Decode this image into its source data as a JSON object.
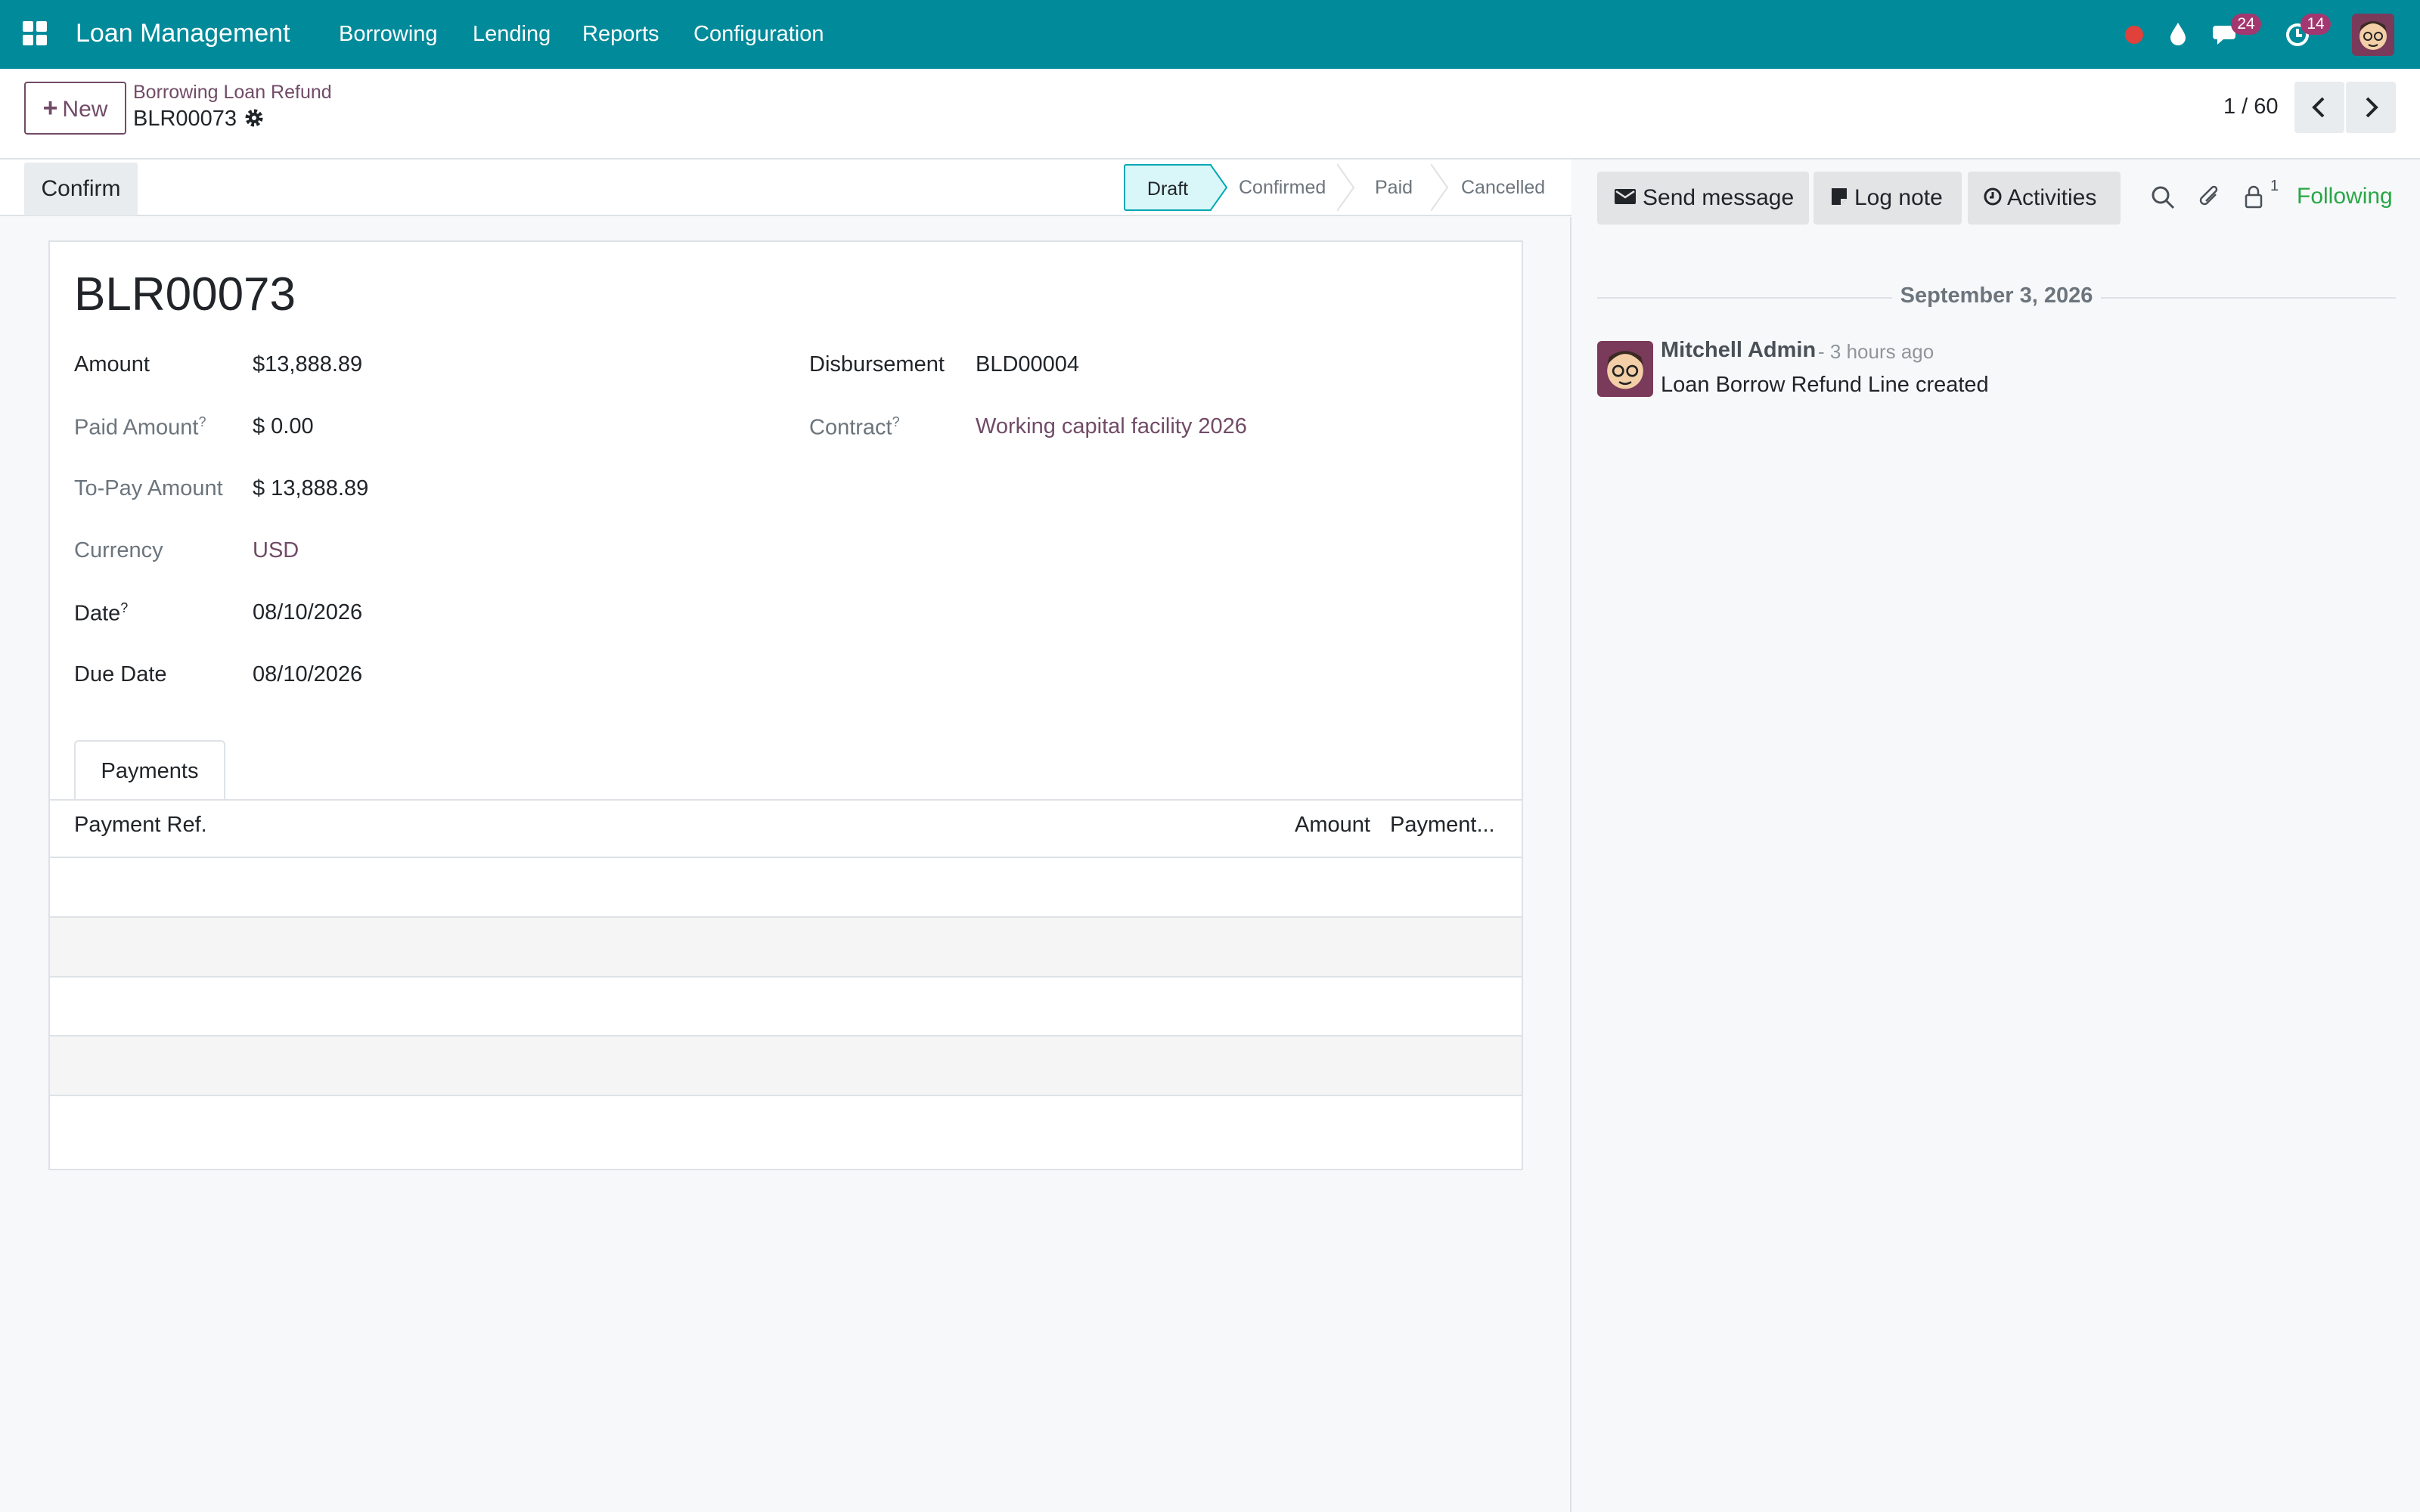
{
  "topbar": {
    "app_title": "Loan Management",
    "menu": [
      "Borrowing",
      "Lending",
      "Reports",
      "Configuration"
    ],
    "messages_count": "24",
    "activities_count": "14",
    "icons": [
      "apps-grid-icon",
      "recording-dot-icon",
      "water-drop-icon",
      "chat-bubble-icon",
      "clock-icon",
      "user-avatar"
    ]
  },
  "control": {
    "new_label": "New",
    "breadcrumb_parent": "Borrowing Loan Refund",
    "breadcrumb_current": "BLR00073",
    "pager": "1 / 60"
  },
  "statusbar": {
    "confirm_label": "Confirm",
    "stages": [
      "Draft",
      "Confirmed",
      "Paid",
      "Cancelled"
    ],
    "active_stage": "Draft"
  },
  "form": {
    "name": "BLR00073",
    "fields_left": [
      {
        "label": "Amount",
        "value": "$13,888.89",
        "help": ""
      },
      {
        "label": "Paid Amount",
        "value": "$ 0.00",
        "help": "?"
      },
      {
        "label": "To-Pay Amount",
        "value": "$ 13,888.89",
        "help": ""
      },
      {
        "label": "Currency",
        "value": "USD",
        "help": ""
      },
      {
        "label": "Date",
        "value": "08/10/2026",
        "help": "?"
      },
      {
        "label": "Due Date",
        "value": "08/10/2026",
        "help": ""
      }
    ],
    "fields_right": [
      {
        "label": "Disbursement",
        "value": "BLD00004",
        "help": ""
      },
      {
        "label": "Contract",
        "value": "Working capital facility 2026",
        "help": "?"
      }
    ],
    "tab_label": "Payments",
    "table_headers": [
      "Payment Ref.",
      "Amount",
      "Payment..."
    ]
  },
  "chatter": {
    "send_message": "Send message",
    "log_note": "Log note",
    "activities": "Activities",
    "followers_count": "1",
    "following": "Following",
    "date": "September 3, 2026",
    "message": {
      "author": "Mitchell Admin",
      "time": "- 3 hours ago",
      "body": "Loan Borrow Refund Line created"
    }
  },
  "colors": {
    "navbar": "#018a9a",
    "brand": "#714b67",
    "active_stage": "#d9f7f8",
    "following": "#28a745"
  }
}
